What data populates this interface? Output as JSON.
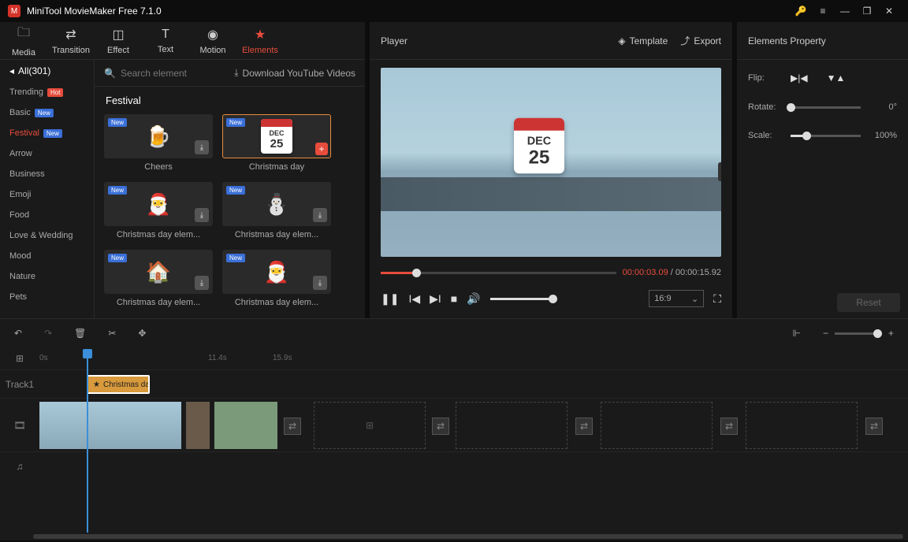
{
  "app": {
    "title": "MiniTool MovieMaker Free 7.1.0"
  },
  "tabs": [
    {
      "label": "Media"
    },
    {
      "label": "Transition"
    },
    {
      "label": "Effect"
    },
    {
      "label": "Text"
    },
    {
      "label": "Motion"
    },
    {
      "label": "Elements"
    }
  ],
  "active_tab": 5,
  "categories": {
    "header": "All(301)",
    "items": [
      {
        "label": "Trending",
        "badge": "Hot"
      },
      {
        "label": "Basic",
        "badge": "New"
      },
      {
        "label": "Festival",
        "badge": "New",
        "selected": true
      },
      {
        "label": "Arrow"
      },
      {
        "label": "Business"
      },
      {
        "label": "Emoji"
      },
      {
        "label": "Food"
      },
      {
        "label": "Love & Wedding"
      },
      {
        "label": "Mood"
      },
      {
        "label": "Nature"
      },
      {
        "label": "Pets"
      }
    ]
  },
  "search": {
    "placeholder": "Search element",
    "download": "Download YouTube Videos"
  },
  "section_title": "Festival",
  "elements": [
    {
      "label": "Cheers",
      "new": true,
      "dl": true
    },
    {
      "label": "Christmas day",
      "new": true,
      "selected": true,
      "add": true
    },
    {
      "label": "Christmas day elem...",
      "new": true,
      "dl": true
    },
    {
      "label": "Christmas day elem...",
      "new": true,
      "dl": true
    },
    {
      "label": "Christmas day elem...",
      "new": true,
      "dl": true
    },
    {
      "label": "Christmas day elem...",
      "new": true,
      "dl": true
    }
  ],
  "player": {
    "title": "Player",
    "template": "Template",
    "export": "Export",
    "current": "00:00:03.09",
    "total": "00:00:15.92",
    "aspect": "16:9"
  },
  "props": {
    "title": "Elements Property",
    "flip": "Flip:",
    "rotate": "Rotate:",
    "rotate_val": "0°",
    "scale": "Scale:",
    "scale_val": "100%",
    "reset": "Reset"
  },
  "timeline": {
    "ticks": [
      "0s",
      "11.4s",
      "15.9s"
    ],
    "track1": "Track1",
    "clip": "Christmas da"
  },
  "cal": {
    "month": "DEC",
    "day": "25"
  }
}
